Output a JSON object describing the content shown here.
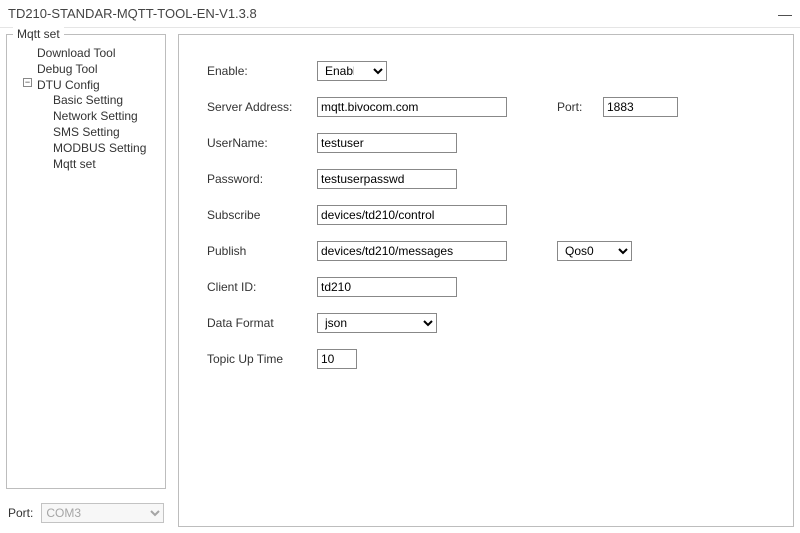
{
  "titlebar": {
    "title": "TD210-STANDAR-MQTT-TOOL-EN-V1.3.8",
    "minimize": "—"
  },
  "sidebar": {
    "group_label": "Mqtt set",
    "tree": {
      "items": [
        {
          "label": "Download Tool"
        },
        {
          "label": "Debug Tool"
        },
        {
          "label": "DTU Config",
          "expanded": "−",
          "children": [
            {
              "label": "Basic Setting"
            },
            {
              "label": "Network Setting"
            },
            {
              "label": "SMS Setting"
            },
            {
              "label": "MODBUS Setting"
            },
            {
              "label": "Mqtt set"
            }
          ]
        }
      ]
    },
    "port_label": "Port:",
    "port_value": "COM3"
  },
  "form": {
    "enable": {
      "label": "Enable:",
      "value": "Enable"
    },
    "server": {
      "label": "Server Address:",
      "value": "mqtt.bivocom.com"
    },
    "port": {
      "label": "Port:",
      "value": "1883"
    },
    "username": {
      "label": "UserName:",
      "value": "testuser"
    },
    "password": {
      "label": "Password:",
      "value": "testuserpasswd"
    },
    "subscribe": {
      "label": "Subscribe",
      "value": "devices/td210/control"
    },
    "publish": {
      "label": "Publish",
      "value": "devices/td210/messages"
    },
    "qos": {
      "value": "Qos0"
    },
    "clientid": {
      "label": "Client ID:",
      "value": "td210"
    },
    "dataformat": {
      "label": "Data Format",
      "value": "json"
    },
    "topicuptime": {
      "label": "Topic Up Time",
      "value": "10"
    }
  }
}
